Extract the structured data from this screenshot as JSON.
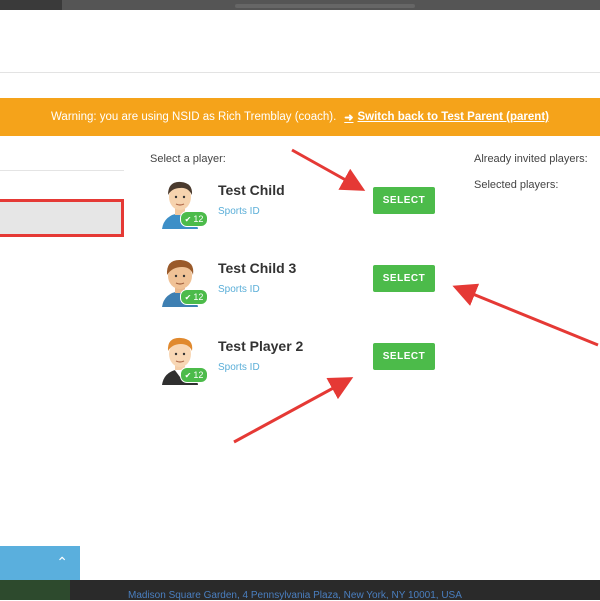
{
  "warning": {
    "message": "Warning: you are using NSID as Rich Tremblay (coach).",
    "switch_icon": "sign-in-icon",
    "switch_link": "Switch back to Test Parent (parent)"
  },
  "labels": {
    "select_player": "Select a player:",
    "already_invited": "Already invited players:",
    "selected_players": "Selected players:"
  },
  "players": [
    {
      "name": "Test Child",
      "sports_id": "Sports ID",
      "age": "12",
      "select_label": "SELECT"
    },
    {
      "name": "Test Child 3",
      "sports_id": "Sports ID",
      "age": "12",
      "select_label": "SELECT"
    },
    {
      "name": "Test Player 2",
      "sports_id": "Sports ID",
      "age": "12",
      "select_label": "SELECT"
    }
  ],
  "footer": {
    "address": "Madison Square Garden, 4 Pennsylvania Plaza, New York, NY 10001, USA"
  },
  "colors": {
    "warning": "#f5a31a",
    "select_button": "#4cbb4a",
    "link": "#5aaed8",
    "annotation": "#e53935"
  }
}
